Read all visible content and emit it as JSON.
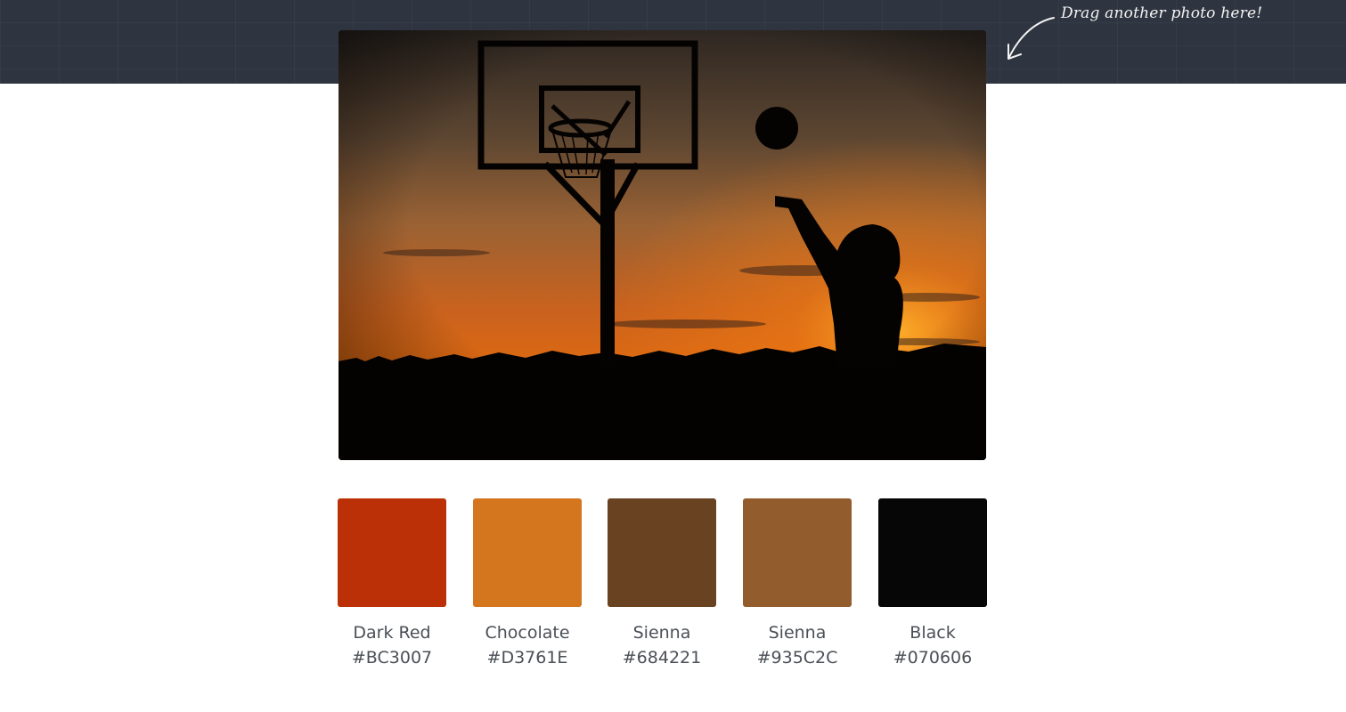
{
  "header": {
    "hint_text": "Drag another photo here!",
    "background_color": "#2f3540",
    "arrow_icon": "curved-arrow-icon"
  },
  "photo": {
    "alt": "Silhouette of a basketball player shooting at a hoop during sunset"
  },
  "palette": {
    "swatches": [
      {
        "name": "Dark Red",
        "hex": "#BC3007"
      },
      {
        "name": "Chocolate",
        "hex": "#D3761E"
      },
      {
        "name": "Sienna",
        "hex": "#684221"
      },
      {
        "name": "Sienna",
        "hex": "#935C2C"
      },
      {
        "name": "Black",
        "hex": "#070606"
      }
    ]
  }
}
